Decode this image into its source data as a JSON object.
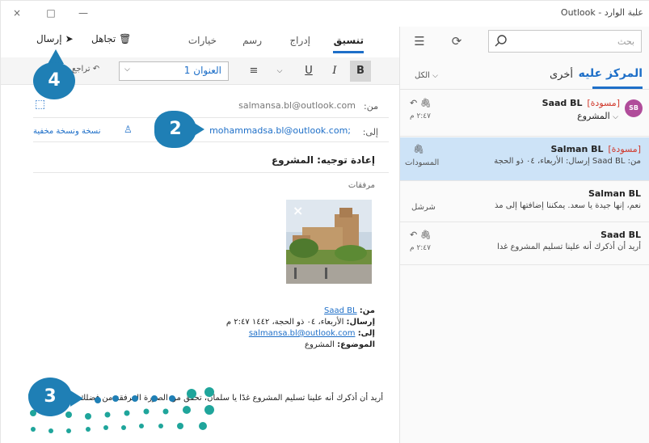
{
  "window": {
    "title": "علبة الوارد - Outlook",
    "controls": {
      "close": "×",
      "maximize": "□",
      "minimize": "—"
    }
  },
  "list": {
    "search_placeholder": "بحث",
    "tabs": {
      "focused": "المركز عليه",
      "other": "أخرى"
    },
    "filter_label": "الكل",
    "messages": [
      {
        "avatar": "SB",
        "draft_tag": "[مسودة]",
        "sender": "Saad BL",
        "subject": "المشروع",
        "time": "٢:٤٧ م"
      },
      {
        "draft_tag": "[مسودة]",
        "sender": "Salman BL",
        "preview": "من: Saad BL إرسال: الأربعاء، ٠٤ ذو الحجة",
        "folder": "المسودات"
      },
      {
        "sender": "Salman BL",
        "preview": "نعم، إنها جيدة يا سعد. يمكننا إضافتها إلى مذ",
        "folder": "شرشل"
      },
      {
        "sender": "Saad BL",
        "preview": "أريد أن أذكرك أنه علينا تسليم المشروع غدا",
        "time": "٢:٤٧ م"
      }
    ]
  },
  "ribbon": {
    "tabs": [
      "تنسيق",
      "إدراج",
      "رسم",
      "خيارات"
    ],
    "send": "إرسال",
    "discard": "تجاهل",
    "undo": "تراجع",
    "style_value": "العنوان 1",
    "bold": "B",
    "italic": "I",
    "underline": "U"
  },
  "compose": {
    "from_label": "من:",
    "from_value": "salmansa.bl@outlook.com",
    "to_label": "إلى:",
    "to_value": "mohammadsa.bl@outlook.com;",
    "bcc_label": "نسخة ونسخة مخفية",
    "subject": "إعادة توجيه: المشروع",
    "attachments_label": "مرفقات",
    "quote": {
      "from_label": "من:",
      "from_value": "Saad BL",
      "sent_label": "إرسال:",
      "sent_value": "الأربعاء، ٠٤ ذو الحجة، ١٤٤٢ ٢:٤٧ م",
      "to_label": "إلى:",
      "to_value": "salmansa.bl@outlook.com",
      "subject_label": "الموضوع:",
      "subject_value": "المشروع"
    },
    "body": "أريد أن أذكرك أنه علينا تسليم المشروع غدًا يا سلمان، تحقق من الصورة المرفقة من فضلك."
  },
  "callouts": {
    "two": "2",
    "three": "3",
    "four": "4"
  },
  "colors": {
    "accent": "#1e6fc8",
    "callout": "#1f7fb5",
    "draft": "#d0382b",
    "selected_row": "#cde3f7"
  }
}
